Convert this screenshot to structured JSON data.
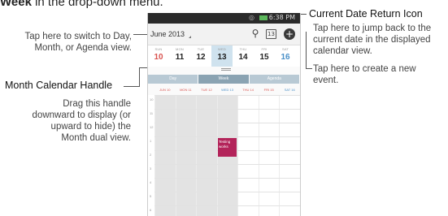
{
  "heading": {
    "bold": "Week",
    "rest": " in the drop-down menu."
  },
  "callouts": {
    "switch_view": {
      "text": "Tap here to switch to Day, Month, or Agenda view."
    },
    "month_handle": {
      "title": "Month Calendar Handle",
      "text": "Drag this handle downward to display (or upward to hide) the Month dual view."
    },
    "current_date": {
      "title": "Current Date Return Icon",
      "text": "Tap here to jump back to the current date in the displayed calendar view."
    },
    "create_event": {
      "text": "Tap here to create a new event."
    }
  },
  "phone": {
    "status_time": "6:38 PM",
    "month_label": "June 2013",
    "today_icon_text": "13",
    "week": [
      {
        "name": "SUN",
        "num": "10"
      },
      {
        "name": "MON",
        "num": "11"
      },
      {
        "name": "TUE",
        "num": "12"
      },
      {
        "name": "WED",
        "num": "13"
      },
      {
        "name": "THU",
        "num": "14"
      },
      {
        "name": "FRI",
        "num": "15"
      },
      {
        "name": "SAT",
        "num": "16"
      }
    ],
    "tabs": [
      "Day",
      "Week",
      "Agenda"
    ],
    "day_heads": [
      "JUN 10",
      "MON 11",
      "TUE 12",
      "WED 13",
      "THU 14",
      "FRI 15",
      "SAT 16"
    ],
    "hours": [
      "10",
      "11",
      "12",
      "1",
      "2",
      "3",
      "4",
      "5",
      "6"
    ],
    "event_title": "Testing works",
    "colors": {
      "event": "#b3245a",
      "selected_day": "#cfe2ee",
      "sunday": "#d9534f",
      "saturday": "#4a90c8"
    }
  }
}
